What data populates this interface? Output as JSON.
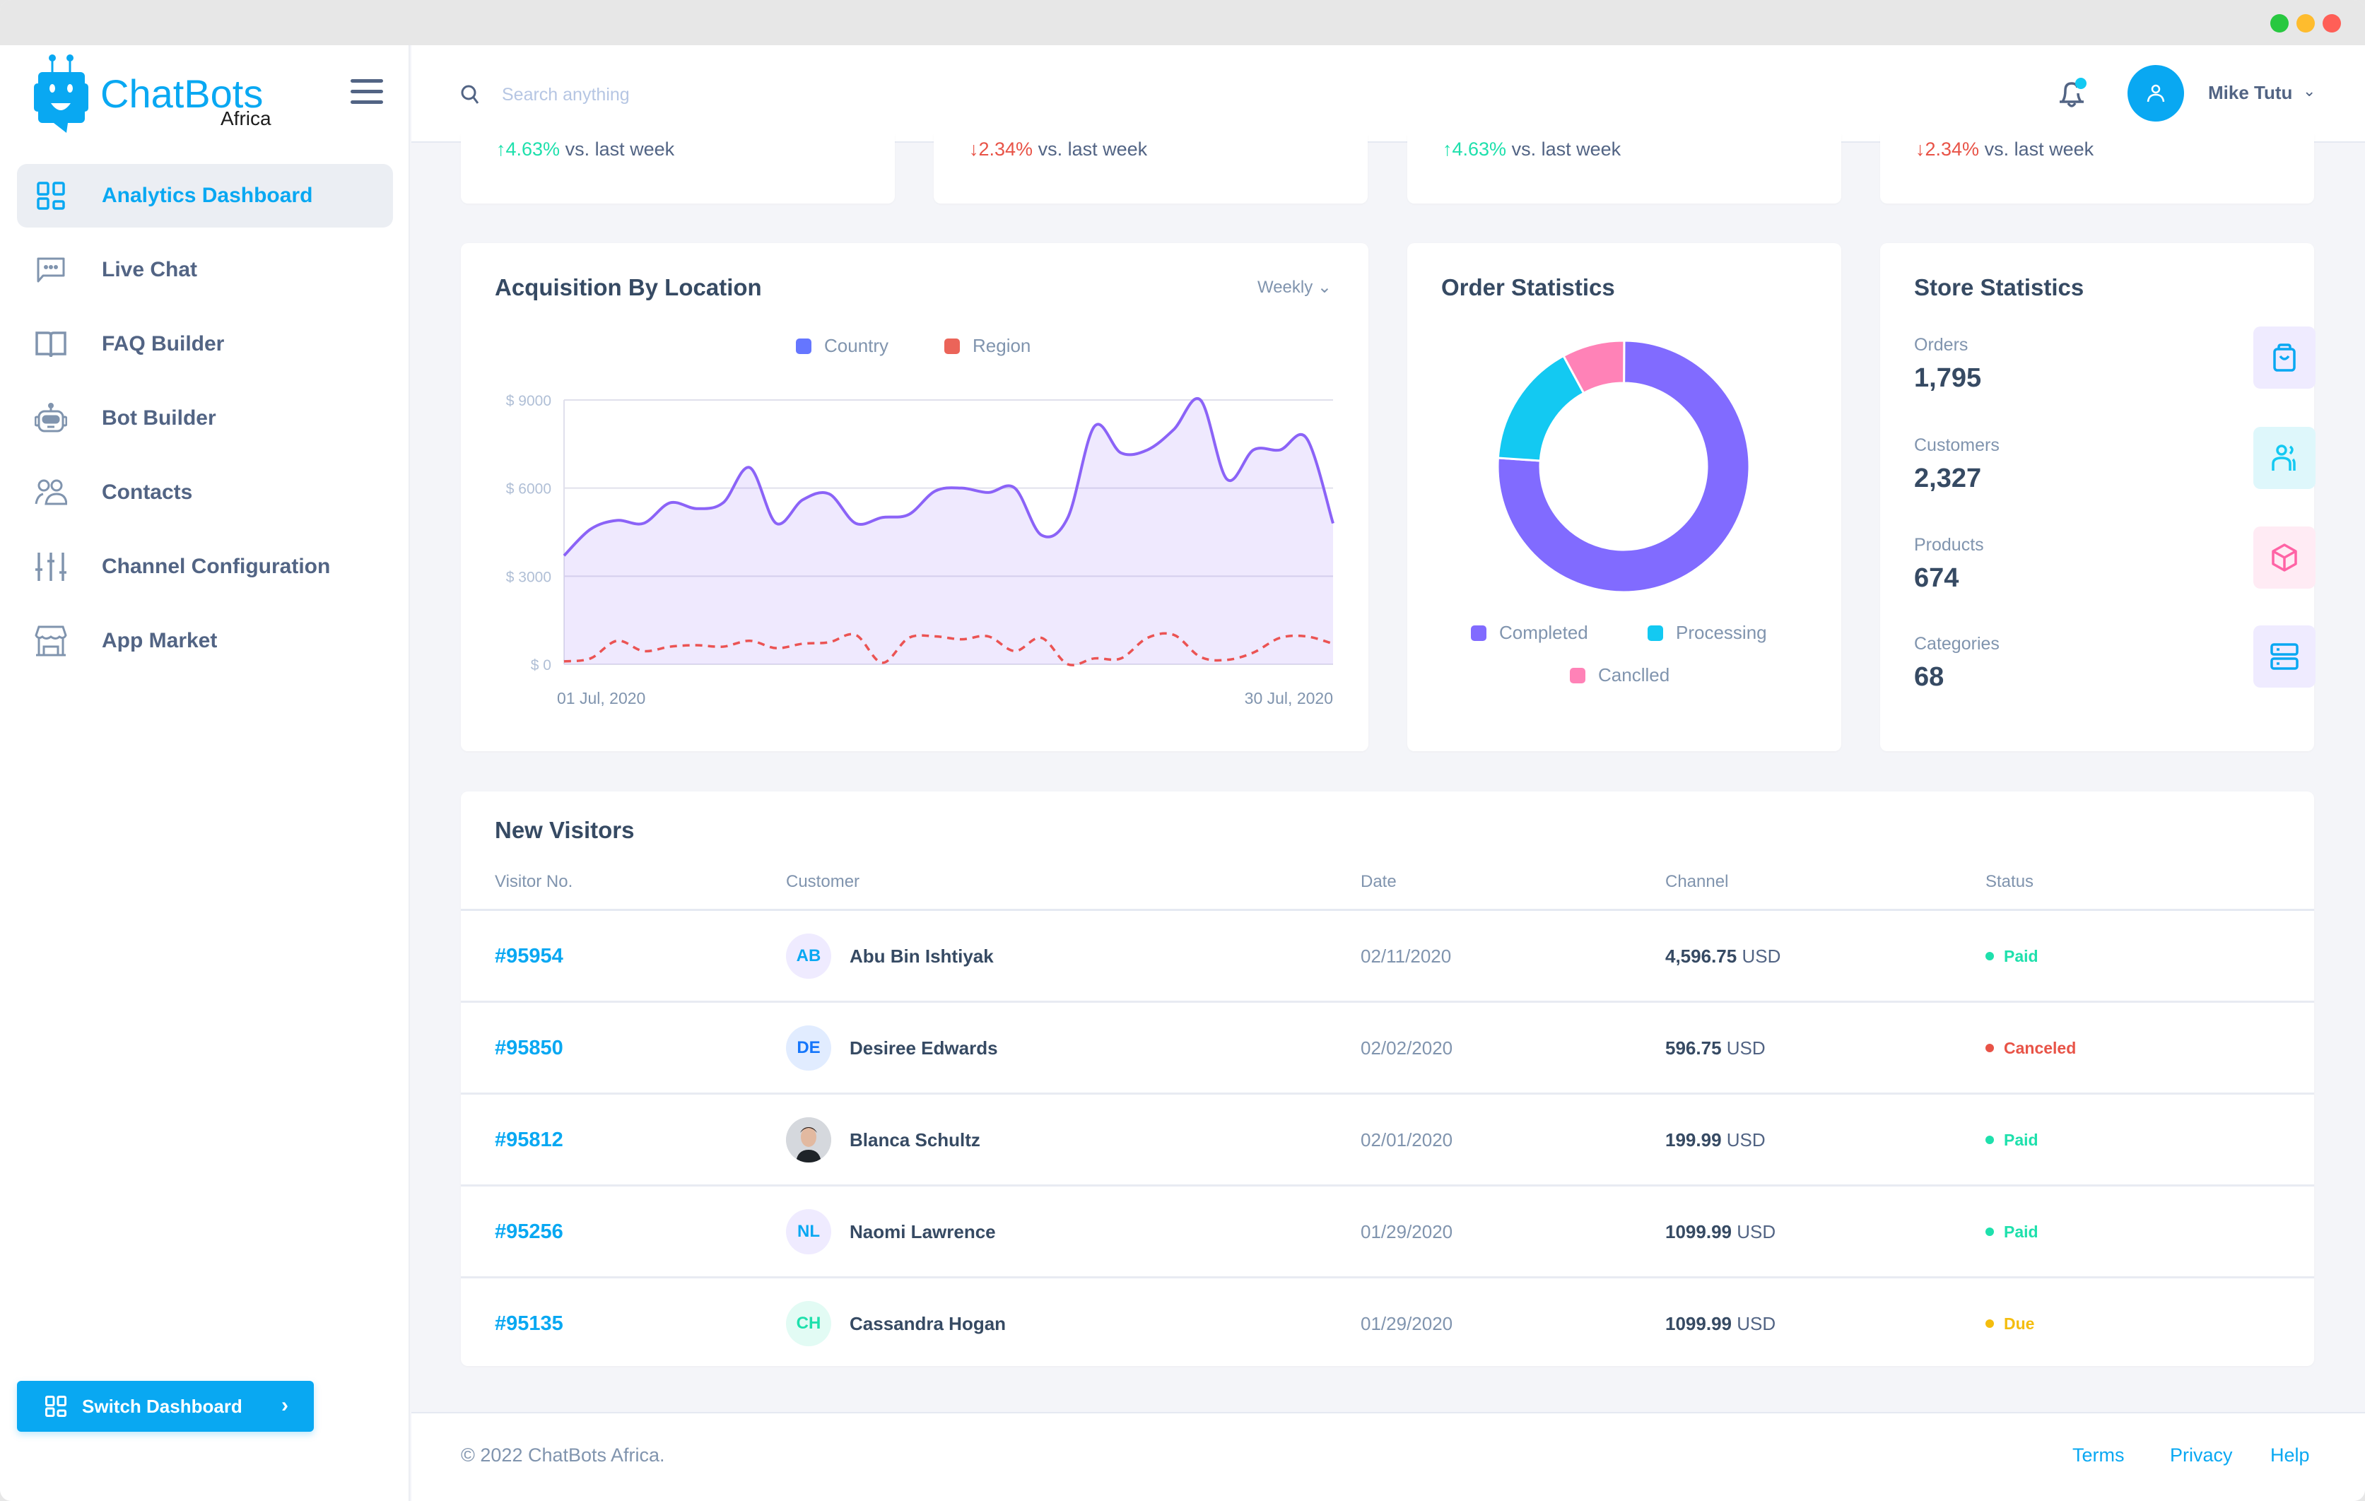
{
  "window": {
    "controls": [
      {
        "name": "maximize",
        "color": "#28c840"
      },
      {
        "name": "minimize",
        "color": "#febc2e"
      },
      {
        "name": "close",
        "color": "#ff5f57"
      }
    ]
  },
  "brand": {
    "name": "ChatBots",
    "sub": "Africa",
    "color": "#09a8f2"
  },
  "sidebar": {
    "items": [
      {
        "label": "Analytics Dashboard",
        "icon": "grid-icon",
        "active": true
      },
      {
        "label": "Live Chat",
        "icon": "chat-bubble-icon"
      },
      {
        "label": "FAQ Builder",
        "icon": "book-icon"
      },
      {
        "label": "Bot Builder",
        "icon": "robot-icon"
      },
      {
        "label": "Contacts",
        "icon": "users-icon"
      },
      {
        "label": "Channel Configuration",
        "icon": "sliders-icon"
      },
      {
        "label": "App Market",
        "icon": "store-icon"
      }
    ],
    "switch_button": "Switch Dashboard"
  },
  "header": {
    "search_placeholder": "Search anything",
    "user_name": "Mike Tutu",
    "notification_dot": true
  },
  "stat_cards": [
    {
      "direction": "up",
      "arrow": "↑",
      "change": "4.63%",
      "suffix": " vs. last week"
    },
    {
      "direction": "down",
      "arrow": "↓",
      "change": "2.34%",
      "suffix": " vs. last week"
    },
    {
      "direction": "up",
      "arrow": "↑",
      "change": "4.63%",
      "suffix": " vs. last week"
    },
    {
      "direction": "down",
      "arrow": "↓",
      "change": "2.34%",
      "suffix": " vs. last week"
    }
  ],
  "acquisition": {
    "title": "Acquisition By Location",
    "period": "Weekly",
    "legend": [
      {
        "label": "Country",
        "color": "#6576ff"
      },
      {
        "label": "Region",
        "color": "#eb6459"
      }
    ]
  },
  "order_stats": {
    "title": "Order Statistics",
    "legend": [
      {
        "label": "Completed",
        "color": "#816bff"
      },
      {
        "label": "Processing",
        "color": "#13c9f2"
      },
      {
        "label": "Canclled",
        "color": "#ff82b7"
      }
    ]
  },
  "store_stats": {
    "title": "Store Statistics",
    "items": [
      {
        "label": "Orders",
        "value": "1,795",
        "icon": "shopping-bag-icon",
        "bg": "#efebff",
        "fg": "#09a8f2"
      },
      {
        "label": "Customers",
        "value": "2,327",
        "icon": "users-icon",
        "bg": "#def7fb",
        "fg": "#13c9f2"
      },
      {
        "label": "Products",
        "value": "674",
        "icon": "box-icon",
        "bg": "#ffebf4",
        "fg": "#ff63a5"
      },
      {
        "label": "Categories",
        "value": "68",
        "icon": "server-icon",
        "bg": "#efebff",
        "fg": "#09a8f2"
      }
    ]
  },
  "visitors": {
    "title": "New Visitors",
    "columns": [
      "Visitor No.",
      "Customer",
      "Date",
      "Channel",
      "Status"
    ],
    "rows": [
      {
        "no": "#95954",
        "initials": "AB",
        "name": "Abu Bin Ishtiyak",
        "date": "02/11/2020",
        "amount": "4,596.75",
        "currency": "USD",
        "status": "Paid",
        "av_bg": "#efebff",
        "av_fg": "#09a8f2",
        "photo": false
      },
      {
        "no": "#95850",
        "initials": "DE",
        "name": "Desiree Edwards",
        "date": "02/02/2020",
        "amount": "596.75",
        "currency": "USD",
        "status": "Canceled",
        "av_bg": "#e1ecff",
        "av_fg": "#1676fb",
        "photo": false
      },
      {
        "no": "#95812",
        "initials": "",
        "name": "Blanca Schultz",
        "date": "02/01/2020",
        "amount": "199.99",
        "currency": "USD",
        "status": "Paid",
        "av_bg": "#d5d8dd",
        "av_fg": "#364a63",
        "photo": true
      },
      {
        "no": "#95256",
        "initials": "NL",
        "name": "Naomi Lawrence",
        "date": "01/29/2020",
        "amount": "1099.99",
        "currency": "USD",
        "status": "Paid",
        "av_bg": "#efebff",
        "av_fg": "#09a8f2",
        "photo": false
      },
      {
        "no": "#95135",
        "initials": "CH",
        "name": "Cassandra Hogan",
        "date": "01/29/2020",
        "amount": "1099.99",
        "currency": "USD",
        "status": "Due",
        "av_bg": "#e2fbf4",
        "av_fg": "#1ee0ac",
        "photo": false
      }
    ],
    "status_colors": {
      "Paid": "#1ee0ac",
      "Canceled": "#e85347",
      "Due": "#f4bd0e"
    }
  },
  "footer": {
    "copyright": "© 2022 ChatBots Africa.",
    "links": [
      "Terms",
      "Privacy",
      "Help"
    ]
  },
  "chart_data": [
    {
      "type": "area",
      "title": "Acquisition By Location",
      "x_labels": [
        "01 Jul, 2020",
        "30 Jul, 2020"
      ],
      "xlabel": "",
      "ylabel": "",
      "y_ticks": [
        "$ 0",
        "$ 3000",
        "$ 6000",
        "$ 9000"
      ],
      "ylim": [
        0,
        9000
      ],
      "grid": true,
      "legend_position": "top-center",
      "series": [
        {
          "name": "Country",
          "style": "solid-area",
          "color": "#8b63f7",
          "values": [
            3700,
            4600,
            4900,
            4800,
            5500,
            5300,
            5500,
            6700,
            4800,
            5600,
            5800,
            4800,
            5000,
            5100,
            5900,
            6000,
            5850,
            6000,
            4400,
            5000,
            8100,
            7200,
            7300,
            8000,
            9000,
            6300,
            7300,
            7300,
            7700,
            4800
          ]
        },
        {
          "name": "Region",
          "style": "dashed",
          "color": "#eb5353",
          "values": [
            100,
            200,
            800,
            450,
            600,
            650,
            600,
            800,
            550,
            700,
            750,
            1000,
            50,
            900,
            950,
            850,
            950,
            450,
            900,
            0,
            200,
            200,
            900,
            1000,
            250,
            150,
            400,
            900,
            950,
            700
          ]
        }
      ]
    },
    {
      "type": "pie",
      "title": "Order Statistics",
      "donut": true,
      "categories": [
        "Completed",
        "Processing",
        "Canclled"
      ],
      "values": [
        76,
        16,
        8
      ],
      "legend_position": "bottom"
    }
  ]
}
